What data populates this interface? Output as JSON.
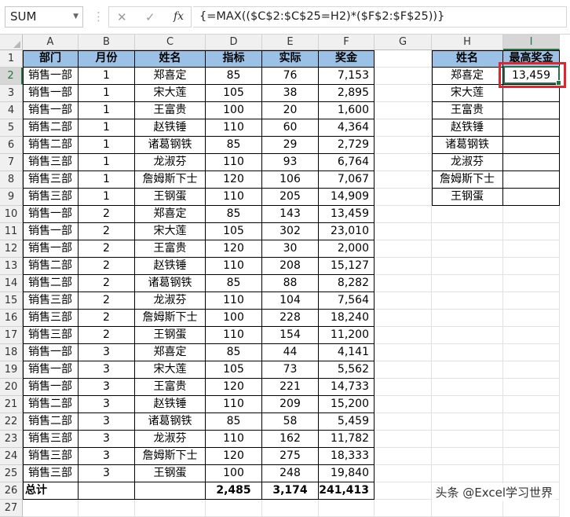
{
  "formula_bar": {
    "name_box": "SUM",
    "cancel_symbol": "✕",
    "enter_symbol": "✓",
    "fx_label": "fx",
    "formula": "{=MAX(($C$2:$C$25=H2)*($F$2:$F$25))}"
  },
  "columns": [
    "A",
    "B",
    "C",
    "D",
    "E",
    "F",
    "G",
    "H",
    "I"
  ],
  "rows": [
    "1",
    "2",
    "3",
    "4",
    "5",
    "6",
    "7",
    "8",
    "9",
    "10",
    "11",
    "12",
    "13",
    "14",
    "15",
    "16",
    "17",
    "18",
    "19",
    "20",
    "21",
    "22",
    "23",
    "24",
    "25",
    "26",
    "27"
  ],
  "table": {
    "headers": [
      "部门",
      "月份",
      "姓名",
      "指标",
      "实际",
      "奖金"
    ],
    "rows": [
      [
        "销售一部",
        "1",
        "郑喜定",
        "85",
        "76",
        "7,153"
      ],
      [
        "销售一部",
        "1",
        "宋大莲",
        "105",
        "38",
        "2,895"
      ],
      [
        "销售一部",
        "1",
        "王富贵",
        "100",
        "20",
        "1,600"
      ],
      [
        "销售二部",
        "1",
        "赵铁锤",
        "110",
        "60",
        "4,364"
      ],
      [
        "销售二部",
        "1",
        "诸葛钢铁",
        "85",
        "29",
        "2,729"
      ],
      [
        "销售三部",
        "1",
        "龙淑芬",
        "110",
        "93",
        "6,764"
      ],
      [
        "销售三部",
        "1",
        "詹姆斯下士",
        "120",
        "106",
        "7,067"
      ],
      [
        "销售三部",
        "1",
        "王钢蛋",
        "110",
        "205",
        "14,909"
      ],
      [
        "销售一部",
        "2",
        "郑喜定",
        "85",
        "143",
        "13,459"
      ],
      [
        "销售一部",
        "2",
        "宋大莲",
        "105",
        "302",
        "23,010"
      ],
      [
        "销售一部",
        "2",
        "王富贵",
        "120",
        "30",
        "2,000"
      ],
      [
        "销售二部",
        "2",
        "赵铁锤",
        "110",
        "208",
        "15,127"
      ],
      [
        "销售二部",
        "2",
        "诸葛钢铁",
        "85",
        "88",
        "8,282"
      ],
      [
        "销售三部",
        "2",
        "龙淑芬",
        "110",
        "104",
        "7,564"
      ],
      [
        "销售三部",
        "2",
        "詹姆斯下士",
        "100",
        "228",
        "18,240"
      ],
      [
        "销售三部",
        "2",
        "王钢蛋",
        "110",
        "154",
        "11,200"
      ],
      [
        "销售一部",
        "3",
        "郑喜定",
        "85",
        "44",
        "4,141"
      ],
      [
        "销售一部",
        "3",
        "宋大莲",
        "105",
        "73",
        "5,562"
      ],
      [
        "销售一部",
        "3",
        "王富贵",
        "120",
        "221",
        "14,733"
      ],
      [
        "销售二部",
        "3",
        "赵铁锤",
        "110",
        "209",
        "15,200"
      ],
      [
        "销售二部",
        "3",
        "诸葛钢铁",
        "85",
        "58",
        "5,459"
      ],
      [
        "销售三部",
        "3",
        "龙淑芬",
        "110",
        "162",
        "11,782"
      ],
      [
        "销售三部",
        "3",
        "詹姆斯下士",
        "120",
        "275",
        "18,333"
      ],
      [
        "销售三部",
        "3",
        "王钢蛋",
        "100",
        "248",
        "19,840"
      ]
    ],
    "total": [
      "总计",
      "",
      "",
      "2,485",
      "3,174",
      "241,413"
    ]
  },
  "lookup": {
    "headers": [
      "姓名",
      "最高奖金"
    ],
    "rows": [
      [
        "郑喜定",
        "13,459"
      ],
      [
        "宋大莲",
        ""
      ],
      [
        "王富贵",
        ""
      ],
      [
        "赵铁锤",
        ""
      ],
      [
        "诸葛钢铁",
        ""
      ],
      [
        "龙淑芬",
        ""
      ],
      [
        "詹姆斯下士",
        ""
      ],
      [
        "王钢蛋",
        ""
      ]
    ]
  },
  "colors": {
    "header_fill": "#9bc2e6",
    "selection_green": "#217346",
    "highlight_red": "#e0262d"
  },
  "selected_cell": "I2",
  "watermark": "头条 @Excel学习世界"
}
